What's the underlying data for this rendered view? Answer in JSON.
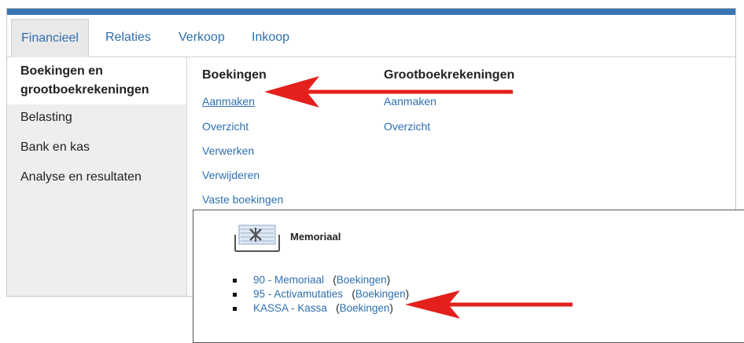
{
  "tabs": [
    {
      "label": "Financieel",
      "active": true
    },
    {
      "label": "Relaties"
    },
    {
      "label": "Verkoop"
    },
    {
      "label": "Inkoop"
    }
  ],
  "sidebar": {
    "active_line1": "Boekingen en",
    "active_line2": "grootboekrekeningen",
    "items": [
      "Belasting",
      "Bank en kas",
      "Analyse en resultaten"
    ]
  },
  "boekingen": {
    "title": "Boekingen",
    "links": [
      "Aanmaken",
      "Overzicht",
      "Verwerken",
      "Verwijderen",
      "Vaste boekingen"
    ]
  },
  "grootboek": {
    "title": "Grootboekrekeningen",
    "links": [
      "Aanmaken",
      "Overzicht"
    ]
  },
  "memoriaal": {
    "title": "Memoriaal",
    "journals": [
      {
        "name": "90 - Memoriaal",
        "action": "Boekingen"
      },
      {
        "name": "95 - Activamutaties",
        "action": "Boekingen"
      },
      {
        "name": "KASSA - Kassa",
        "action": "Boekingen"
      }
    ]
  },
  "colors": {
    "accent_bar": "#3a75b0",
    "link": "#2e6fb0",
    "arrow": "#e3201b"
  },
  "icons": [
    "memoriaal-journal-icon",
    "annotation-arrow"
  ]
}
